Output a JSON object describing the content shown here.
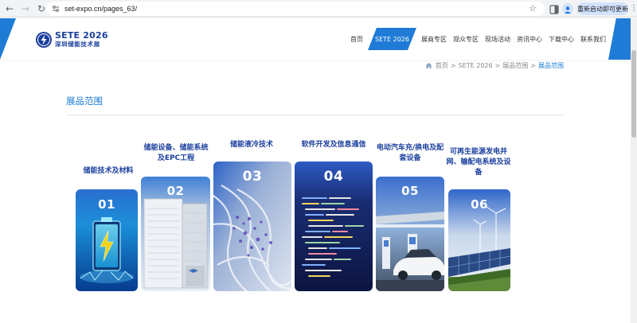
{
  "browser": {
    "url": "set-expo.cn/pages_63/",
    "update_label": "重新启动即可更新",
    "icons": [
      "back-arrow-icon",
      "forward-arrow-icon",
      "reload-icon",
      "site-info-icon",
      "bookmark-star-icon",
      "side-panel-icon",
      "profile-icon",
      "menu-icon"
    ]
  },
  "header": {
    "logo_en": "SETE 2026",
    "logo_cn": "深圳储能技术展",
    "nav": [
      {
        "label": "首页",
        "active": false
      },
      {
        "label": "SETE 2026",
        "active": true
      },
      {
        "label": "展商专区",
        "active": false
      },
      {
        "label": "观众专区",
        "active": false
      },
      {
        "label": "现场活动",
        "active": false
      },
      {
        "label": "资讯中心",
        "active": false
      },
      {
        "label": "下载中心",
        "active": false
      },
      {
        "label": "联系我们",
        "active": false
      }
    ]
  },
  "breadcrumb": {
    "home": "首页",
    "sep1": ">",
    "item1": "SETE 2026",
    "sep2": ">",
    "item2": "展品范围",
    "sep3": ">",
    "current": "展品范围"
  },
  "section": {
    "title": "展品范围"
  },
  "cards": [
    {
      "num": "01",
      "label": "储能技术及材料"
    },
    {
      "num": "02",
      "label": "储能设备、储能系统及EPC工程"
    },
    {
      "num": "03",
      "label": "储能液冷技术"
    },
    {
      "num": "04",
      "label": "软件开发及信息通信"
    },
    {
      "num": "05",
      "label": "电动汽车充/换电及配套设备"
    },
    {
      "num": "06",
      "label": "可再生能源发电并网、输配电系统及设备"
    }
  ],
  "colors": {
    "brand_blue": "#1e7bd6",
    "logo_navy": "#1b3f9e"
  }
}
